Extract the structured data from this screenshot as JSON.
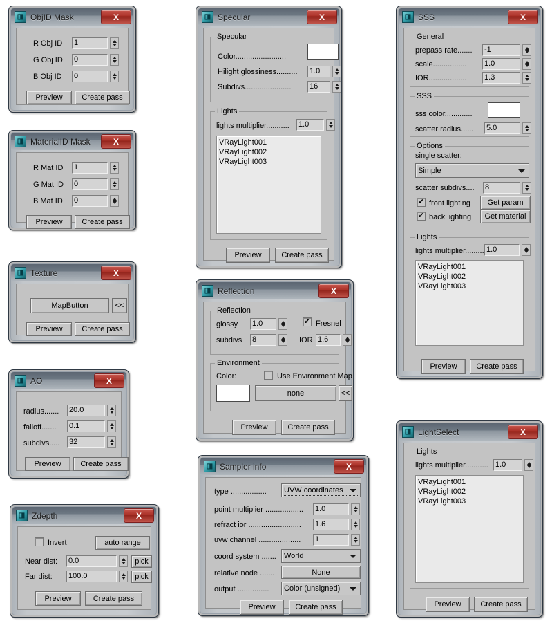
{
  "common": {
    "icon_glyph": "◨",
    "icon_name": "vray-app-icon",
    "close_label": "X",
    "preview_label": "Preview",
    "create_pass_label": "Create pass",
    "lights_list": [
      "VRayLight001",
      "VRayLight002",
      "VRayLight003"
    ],
    "lights_group_label": "Lights",
    "lights_multiplier_label": "lights multiplier...........",
    "lights_multiplier_value": "1.0",
    "checked_glyph": "✔"
  },
  "objid": {
    "title": "ObjID Mask",
    "rows": [
      {
        "label": "R Obj ID",
        "value": "1"
      },
      {
        "label": "G Obj ID",
        "value": "0"
      },
      {
        "label": "B Obj ID",
        "value": "0"
      }
    ]
  },
  "matid": {
    "title": "MaterialID Mask",
    "rows": [
      {
        "label": "R Mat ID",
        "value": "1"
      },
      {
        "label": "G Mat ID",
        "value": "0"
      },
      {
        "label": "B Mat ID",
        "value": "0"
      }
    ]
  },
  "texture": {
    "title": "Texture",
    "map_button_label": "MapButton",
    "expand_label": "<<"
  },
  "ao": {
    "title": "AO",
    "rows": [
      {
        "label": "radius.......",
        "value": "20.0"
      },
      {
        "label": "falloff.......",
        "value": "0.1"
      },
      {
        "label": "subdivs.....",
        "value": "32"
      }
    ]
  },
  "zdepth": {
    "title": "Zdepth",
    "invert_label": "Invert",
    "invert_checked": false,
    "auto_range_label": "auto range",
    "near_label": "Near dist:",
    "near_value": "0.0",
    "far_label": "Far dist:",
    "far_value": "100.0",
    "pick_label": "pick"
  },
  "specular": {
    "title": "Specular",
    "group_label": "Specular",
    "color_label": "Color........................",
    "color_value": "#ffffff",
    "hilight_label": "Hilight glossiness..........",
    "hilight_value": "1.0",
    "subdivs_label": "Subdivs......................",
    "subdivs_value": "16"
  },
  "reflection": {
    "title": "Reflection",
    "group_label": "Reflection",
    "glossy_label": "glossy",
    "glossy_value": "1.0",
    "subdivs_label": "subdivs",
    "subdivs_value": "8",
    "fresnel_label": "Fresnel",
    "fresnel_checked": true,
    "ior_label": "IOR",
    "ior_value": "1.6",
    "env_group_label": "Environment",
    "color_label": "Color:",
    "use_env_map_label": "Use Environment Map",
    "use_env_map_checked": false,
    "env_color_value": "#ffffff",
    "map_value": "none",
    "expand_label": "<<"
  },
  "sampler": {
    "title": "Sampler info",
    "type_label": "type .................",
    "type_value": "UVW coordinates",
    "point_mult_label": "point multiplier ..................",
    "point_mult_value": "1.0",
    "refract_ior_label": "refract ior .........................",
    "refract_ior_value": "1.6",
    "uvw_channel_label": "uvw channel ....................",
    "uvw_channel_value": "1",
    "coord_system_label": "coord system .......",
    "coord_system_value": "World",
    "relative_node_label": "relative node .......",
    "relative_node_value": "None",
    "output_label": "output ...............",
    "output_value": "Color (unsigned)"
  },
  "sss": {
    "title": "SSS",
    "general_group_label": "General",
    "prepass_label": "prepass rate.......",
    "prepass_value": "-1",
    "scale_label": "scale................",
    "scale_value": "1.0",
    "ior_label": "IOR..................",
    "ior_value": "1.3",
    "sss_group_label": "SSS",
    "sss_color_label": "sss color.............",
    "sss_color_value": "#ffffff",
    "scatter_radius_label": "scatter radius......",
    "scatter_radius_value": "5.0",
    "options_group_label": "Options",
    "single_scatter_label": "single scatter:",
    "single_scatter_value": "Simple",
    "scatter_subdivs_label": "scatter subdivs....",
    "scatter_subdivs_value": "8",
    "front_lighting_label": "front lighting",
    "front_lighting_checked": true,
    "back_lighting_label": "back lighting",
    "back_lighting_checked": true,
    "get_param_label": "Get param",
    "get_material_label": "Get material"
  },
  "lightselect": {
    "title": "LightSelect"
  }
}
